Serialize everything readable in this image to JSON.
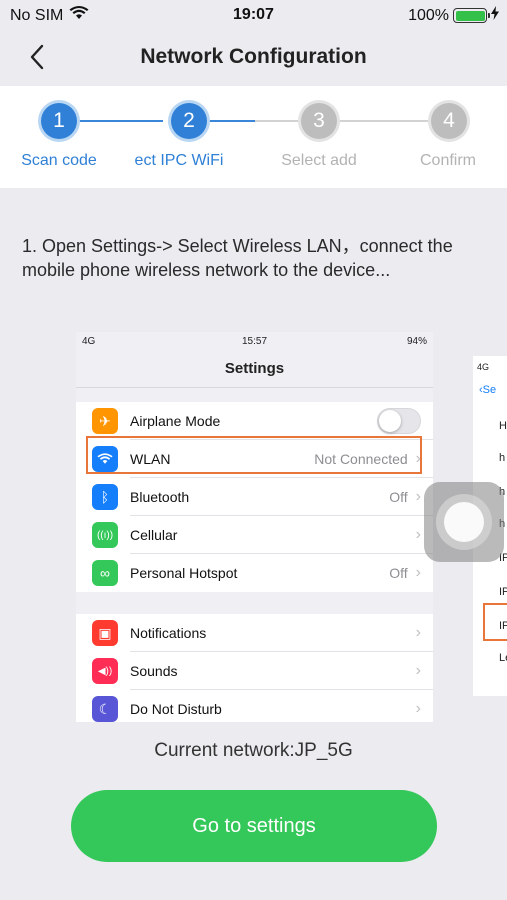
{
  "status_bar": {
    "carrier": "No SIM",
    "time": "19:07",
    "battery": "100%"
  },
  "nav": {
    "title": "Network Configuration",
    "back_icon": "chevron-left-icon"
  },
  "steps": [
    {
      "number": "1",
      "label": "Scan code",
      "state": "active"
    },
    {
      "number": "2",
      "label": "ect IPC WiFi",
      "state": "active"
    },
    {
      "number": "3",
      "label": "Select add",
      "state": "inactive"
    },
    {
      "number": "4",
      "label": "Confirm",
      "state": "inactive"
    }
  ],
  "instruction": "1. Open Settings-> Select Wireless LAN，connect the mobile phone wireless network to the device...",
  "screenshot": {
    "status": {
      "signal": "4G",
      "time": "15:57",
      "battery": "94%"
    },
    "title": "Settings",
    "group1": [
      {
        "icon": "airplane-icon",
        "color": "#ff9500",
        "glyph": "✈",
        "label": "Airplane Mode",
        "value": "",
        "toggle": true
      },
      {
        "icon": "wifi-icon",
        "color": "#147efb",
        "glyph": "wifi",
        "label": "WLAN",
        "value": "Not Connected",
        "toggle": false
      },
      {
        "icon": "bluetooth-icon",
        "color": "#147efb",
        "glyph": "ᛒ",
        "label": "Bluetooth",
        "value": "Off",
        "toggle": false
      },
      {
        "icon": "cellular-icon",
        "color": "#34c759",
        "glyph": "((ı))",
        "label": "Cellular",
        "value": "",
        "toggle": false
      },
      {
        "icon": "hotspot-icon",
        "color": "#34c759",
        "glyph": "∞",
        "label": "Personal Hotspot",
        "value": "Off",
        "toggle": false
      }
    ],
    "group2": [
      {
        "icon": "notifications-icon",
        "color": "#ff3b30",
        "glyph": "▣",
        "label": "Notifications",
        "value": ""
      },
      {
        "icon": "sounds-icon",
        "color": "#ff2d55",
        "glyph": "◀))",
        "label": "Sounds",
        "value": ""
      },
      {
        "icon": "do-not-disturb-icon",
        "color": "#5856d6",
        "glyph": "☾",
        "label": "Do Not Disturb",
        "value": ""
      }
    ]
  },
  "screenshot2": {
    "signal": "4G",
    "back": "Se",
    "items": [
      "H",
      "h",
      "h",
      "h",
      "IP",
      "IP",
      "IP",
      "Le"
    ]
  },
  "current_network": "Current network:JP_5G",
  "go_button": "Go to settings"
}
